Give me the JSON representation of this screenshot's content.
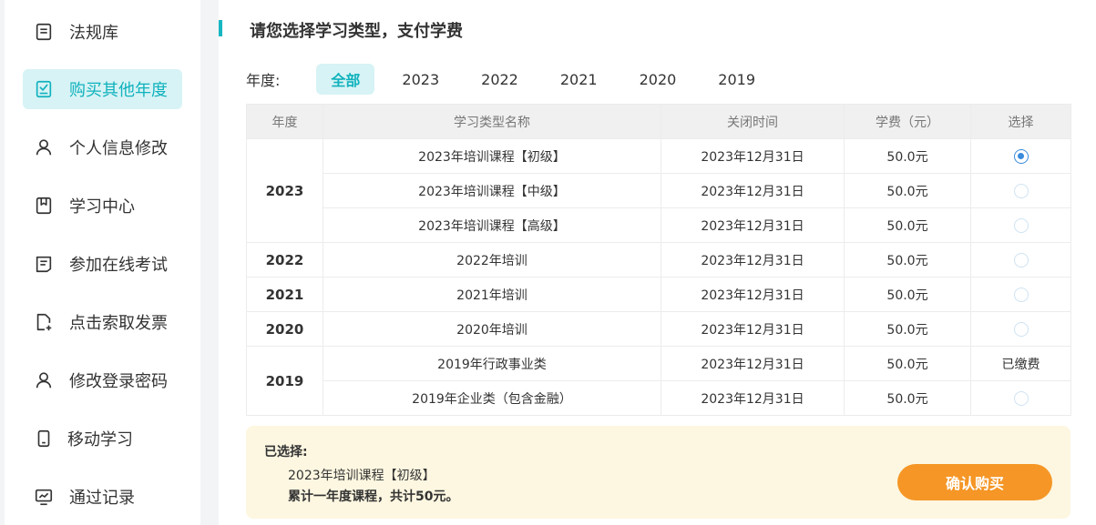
{
  "sidebar": {
    "items": [
      {
        "label": "法规库",
        "icon": "document-icon"
      },
      {
        "label": "购买其他年度",
        "icon": "checklist-icon",
        "active": true
      },
      {
        "label": "个人信息修改",
        "icon": "user-icon"
      },
      {
        "label": "学习中心",
        "icon": "book-icon"
      },
      {
        "label": "参加在线考试",
        "icon": "exam-icon"
      },
      {
        "label": "点击索取发票",
        "icon": "invoice-icon"
      },
      {
        "label": "修改登录密码",
        "icon": "user-icon"
      },
      {
        "label": "移动学习",
        "icon": "mobile-icon"
      },
      {
        "label": "通过记录",
        "icon": "chart-icon"
      }
    ]
  },
  "main": {
    "title": "请您选择学习类型，支付学费",
    "year_filter": {
      "label": "年度:",
      "tabs": [
        "全部",
        "2023",
        "2022",
        "2021",
        "2020",
        "2019"
      ],
      "active": "全部"
    },
    "table": {
      "headers": [
        "年度",
        "学习类型名称",
        "关闭时间",
        "学费（元）",
        "选择"
      ],
      "groups": [
        {
          "year": "2023",
          "rows": [
            {
              "name": "2023年培训课程【初级】",
              "close": "2023年12月31日",
              "fee": "50.0元",
              "select": "checked"
            },
            {
              "name": "2023年培训课程【中级】",
              "close": "2023年12月31日",
              "fee": "50.0元",
              "select": "radio"
            },
            {
              "name": "2023年培训课程【高级】",
              "close": "2023年12月31日",
              "fee": "50.0元",
              "select": "radio"
            }
          ]
        },
        {
          "year": "2022",
          "rows": [
            {
              "name": "2022年培训",
              "close": "2023年12月31日",
              "fee": "50.0元",
              "select": "radio"
            }
          ]
        },
        {
          "year": "2021",
          "rows": [
            {
              "name": "2021年培训",
              "close": "2023年12月31日",
              "fee": "50.0元",
              "select": "radio"
            }
          ]
        },
        {
          "year": "2020",
          "rows": [
            {
              "name": "2020年培训",
              "close": "2023年12月31日",
              "fee": "50.0元",
              "select": "radio"
            }
          ]
        },
        {
          "year": "2019",
          "rows": [
            {
              "name": "2019年行政事业类",
              "close": "2023年12月31日",
              "fee": "50.0元",
              "select": "已缴费"
            },
            {
              "name": "2019年企业类（包含金融）",
              "close": "2023年12月31日",
              "fee": "50.0元",
              "select": "radio"
            }
          ]
        }
      ]
    },
    "summary": {
      "label": "已选择:",
      "course": "2023年培训课程【初级】",
      "total": "累计一年度课程，共计50元。",
      "confirm_label": "确认购买"
    }
  },
  "colors": {
    "accent": "#0fb2bd",
    "active_bg": "#d7f3f5",
    "radio_checked": "#3a8bdc",
    "confirm_button": "#f59626",
    "summary_bg": "#fdf7e1"
  }
}
